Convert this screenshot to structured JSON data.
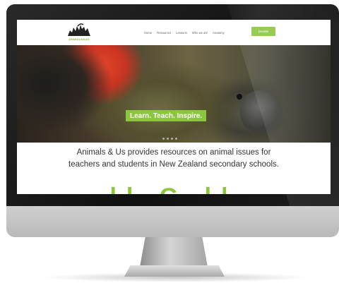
{
  "site": {
    "logo_text": "ANIMALS&US",
    "nav": {
      "links": [
        "Home",
        "Resources",
        "Lessons",
        "Who we are",
        "Anatomy"
      ],
      "donate_label": "Donate"
    },
    "hero": {
      "slogan": "Learn. Teach. Inspire.",
      "dots": 4
    },
    "intro": {
      "line1": "Animals & Us provides resources on animal issues for",
      "line2": "teachers and students in New Zealand secondary schools."
    },
    "teaser_text": "ll  G  ll"
  },
  "colors": {
    "accent_green": "#8cc63f",
    "bezel": "#111111",
    "chin": "#c4c4c4"
  }
}
